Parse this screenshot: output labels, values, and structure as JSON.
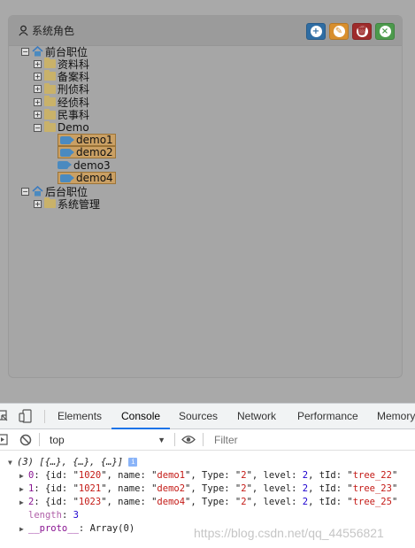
{
  "panel": {
    "title": "系统角色",
    "buttons": [
      {
        "name": "add-button",
        "icon": "plus-icon",
        "color": "#2f6da3",
        "glyph": "+"
      },
      {
        "name": "edit-button",
        "icon": "pencil-icon",
        "color": "#d88f2e",
        "glyph": "✎"
      },
      {
        "name": "delete-button",
        "icon": "trash-icon",
        "color": "#9e2b2b",
        "glyph": "🗑"
      },
      {
        "name": "close-button",
        "icon": "close-icon",
        "color": "#4c9a4c",
        "glyph": "×"
      }
    ]
  },
  "tree": {
    "front_root": "前台职位",
    "front_children": [
      "资料科",
      "备案科",
      "刑侦科",
      "经侦科",
      "民事科"
    ],
    "demo_folder": "Demo",
    "demo_children": [
      {
        "label": "demo1",
        "selected": true
      },
      {
        "label": "demo2",
        "selected": true
      },
      {
        "label": "demo3",
        "selected": false
      },
      {
        "label": "demo4",
        "selected": true
      }
    ],
    "back_root": "后台职位",
    "back_children": [
      "系统管理"
    ]
  },
  "devtools": {
    "tabs": [
      "Elements",
      "Console",
      "Sources",
      "Network",
      "Performance",
      "Memory"
    ],
    "active_tab": "Console",
    "context": "top",
    "filter_placeholder": "Filter",
    "console": {
      "summary": "(3) [{…}, {…}, {…}]",
      "rows": [
        {
          "index": "0",
          "id": "1020",
          "name": "demo1",
          "Type": "2",
          "level": "2",
          "tId": "tree_22"
        },
        {
          "index": "1",
          "id": "1021",
          "name": "demo2",
          "Type": "2",
          "level": "2",
          "tId": "tree_23"
        },
        {
          "index": "2",
          "id": "1023",
          "name": "demo4",
          "Type": "2",
          "level": "2",
          "tId": "tree_25"
        }
      ],
      "length_key": "length",
      "length_value": "3",
      "proto_key": "__proto__",
      "proto_value": "Array(0)"
    }
  },
  "watermark": "https://blog.csdn.net/qq_44556821"
}
